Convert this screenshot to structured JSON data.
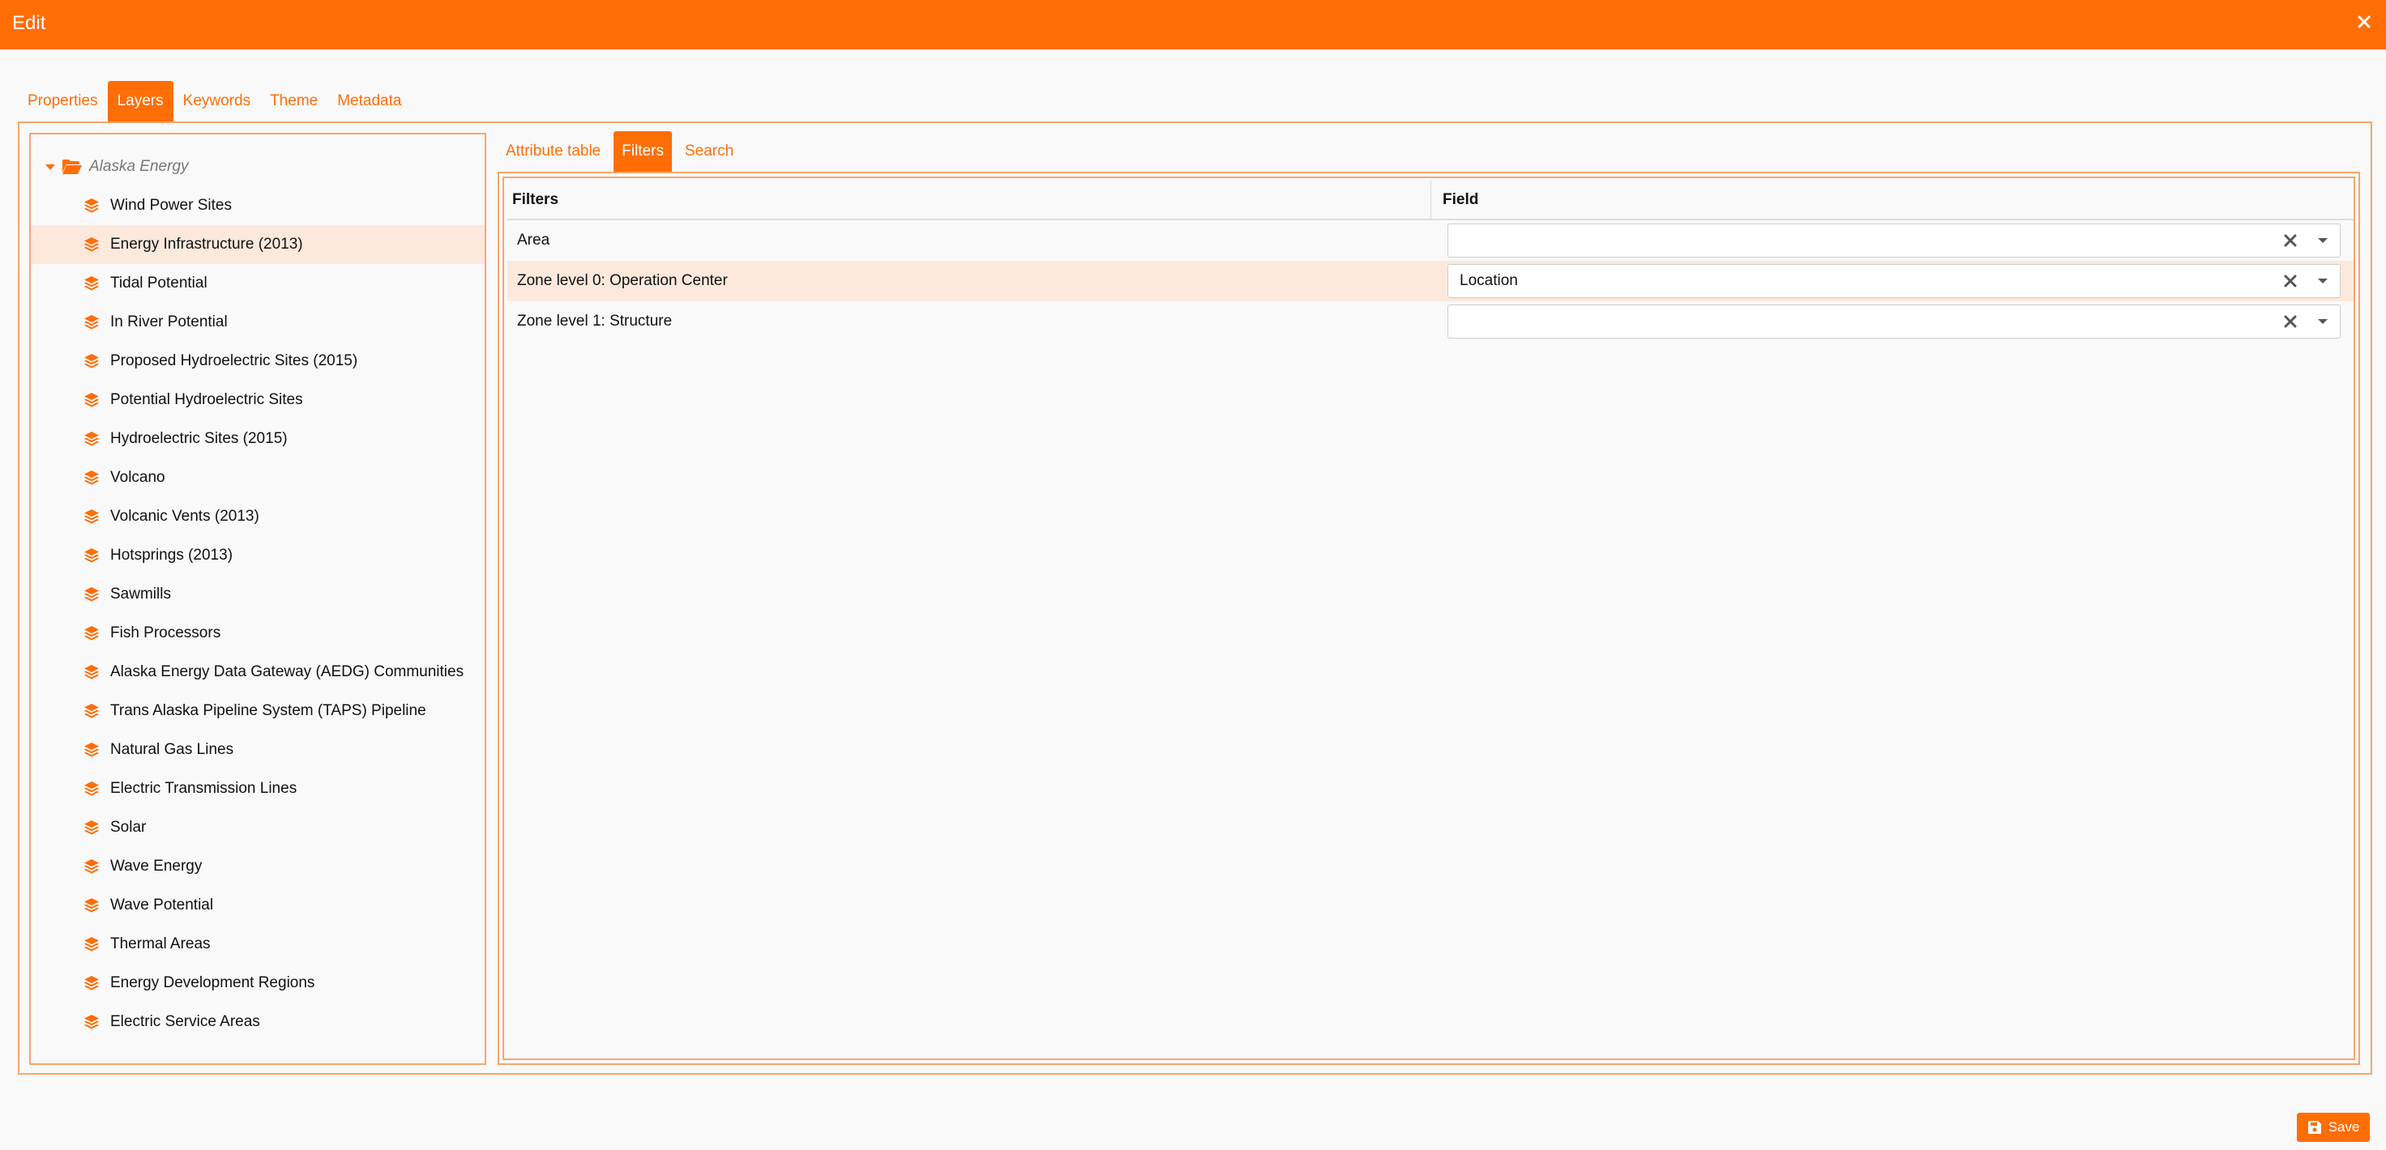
{
  "window": {
    "title": "Edit",
    "close_icon": "close-icon"
  },
  "main_tabs": [
    {
      "label": "Properties",
      "active": false
    },
    {
      "label": "Layers",
      "active": true
    },
    {
      "label": "Keywords",
      "active": false
    },
    {
      "label": "Theme",
      "active": false
    },
    {
      "label": "Metadata",
      "active": false
    }
  ],
  "tree": {
    "root_label": "Alaska Energy",
    "root_icons": [
      "caret-down-icon",
      "folder-open-icon"
    ],
    "layer_icon": "layers-icon",
    "items": [
      {
        "label": "Wind Power Sites",
        "selected": false
      },
      {
        "label": "Energy Infrastructure (2013)",
        "selected": true
      },
      {
        "label": "Tidal Potential",
        "selected": false
      },
      {
        "label": "In River Potential",
        "selected": false
      },
      {
        "label": "Proposed Hydroelectric Sites (2015)",
        "selected": false
      },
      {
        "label": "Potential Hydroelectric Sites",
        "selected": false
      },
      {
        "label": "Hydroelectric Sites (2015)",
        "selected": false
      },
      {
        "label": "Volcano",
        "selected": false
      },
      {
        "label": "Volcanic Vents (2013)",
        "selected": false
      },
      {
        "label": "Hotsprings (2013)",
        "selected": false
      },
      {
        "label": "Sawmills",
        "selected": false
      },
      {
        "label": "Fish Processors",
        "selected": false
      },
      {
        "label": "Alaska Energy Data Gateway (AEDG) Communities",
        "selected": false
      },
      {
        "label": "Trans Alaska Pipeline System (TAPS) Pipeline",
        "selected": false
      },
      {
        "label": "Natural Gas Lines",
        "selected": false
      },
      {
        "label": "Electric Transmission Lines",
        "selected": false
      },
      {
        "label": "Solar",
        "selected": false
      },
      {
        "label": "Wave Energy",
        "selected": false
      },
      {
        "label": "Wave Potential",
        "selected": false
      },
      {
        "label": "Thermal Areas",
        "selected": false
      },
      {
        "label": "Energy Development Regions",
        "selected": false
      },
      {
        "label": "Electric Service Areas",
        "selected": false
      }
    ]
  },
  "sub_tabs": [
    {
      "label": "Attribute table",
      "active": false
    },
    {
      "label": "Filters",
      "active": true
    },
    {
      "label": "Search",
      "active": false
    }
  ],
  "filters_table": {
    "headers": {
      "filters": "Filters",
      "field": "Field"
    },
    "rows": [
      {
        "filter": "Area",
        "field": "",
        "selected": false
      },
      {
        "filter": "Zone level 0: Operation Center",
        "field": "Location",
        "selected": true
      },
      {
        "filter": "Zone level 1: Structure",
        "field": "",
        "selected": false
      }
    ]
  },
  "footer": {
    "save_label": "Save",
    "save_icon": "save-icon"
  },
  "colors": {
    "accent": "#ff6d05",
    "selected_row": "#fce9dc",
    "border": "#f8a56a"
  }
}
